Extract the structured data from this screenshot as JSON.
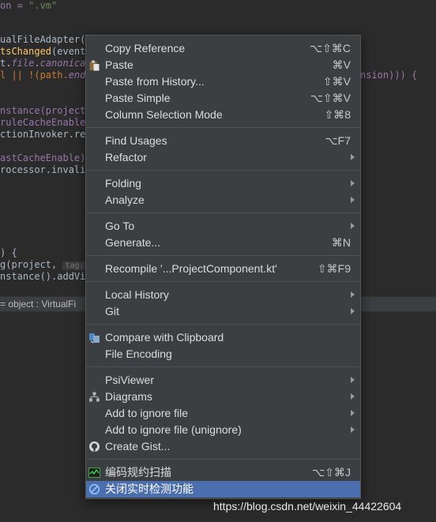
{
  "code": {
    "l1a": "on = ",
    "l1b": "\".vm\"",
    "l2a": "ualFileAdapter(",
    "l3a": "tsChanged",
    "l3b": "(event:",
    "l4a": "t.",
    "l4b": "file",
    "l4c": ".",
    "l4d": "canonical",
    "l5a": "l || !(path.",
    "l5b": "ends",
    "l5tail": "nsion))) {",
    "l6a": "nstance(project)",
    "l7a": "ruleCacheEnable)",
    "l8a": "ctionInvoker.ref",
    "l9a": "astCacheEnable)",
    "l10a": "rocessor.invalid",
    "l11a": ") {",
    "l12a": "g(project,",
    "l12hint": "tag:",
    "l13a": "nstance().addVir"
  },
  "breadcrumb": {
    "text": "= object : VirtualFi"
  },
  "menu": {
    "items": [
      {
        "label": "Copy Reference",
        "shortcut": "⌥⇧⌘C"
      },
      {
        "label": "Paste",
        "shortcut": "⌘V"
      },
      {
        "label": "Paste from History...",
        "shortcut": "⇧⌘V"
      },
      {
        "label": "Paste Simple",
        "shortcut": "⌥⇧⌘V"
      },
      {
        "label": "Column Selection Mode",
        "shortcut": "⇧⌘8"
      },
      {
        "label": "Find Usages",
        "shortcut": "⌥F7"
      },
      {
        "label": "Refactor"
      },
      {
        "label": "Folding"
      },
      {
        "label": "Analyze"
      },
      {
        "label": "Go To"
      },
      {
        "label": "Generate...",
        "shortcut": "⌘N"
      },
      {
        "label": "Recompile '...ProjectComponent.kt'",
        "shortcut": "⇧⌘F9"
      },
      {
        "label": "Local History"
      },
      {
        "label": "Git"
      },
      {
        "label": "Compare with Clipboard"
      },
      {
        "label": "File Encoding"
      },
      {
        "label": "PsiViewer"
      },
      {
        "label": "Diagrams"
      },
      {
        "label": "Add to ignore file"
      },
      {
        "label": "Add to ignore file (unignore)"
      },
      {
        "label": "Create Gist..."
      },
      {
        "label": "编码规约扫描",
        "shortcut": "⌥⇧⌘J"
      },
      {
        "label": "关闭实时检测功能"
      }
    ],
    "selected": "关闭实时检测功能"
  },
  "colors": {
    "editor_bg": "#2b2b2b",
    "menu_bg": "#3c3f41",
    "selection": "#4b6eaf"
  },
  "watermark": "https://blog.csdn.net/weixin_44422604"
}
